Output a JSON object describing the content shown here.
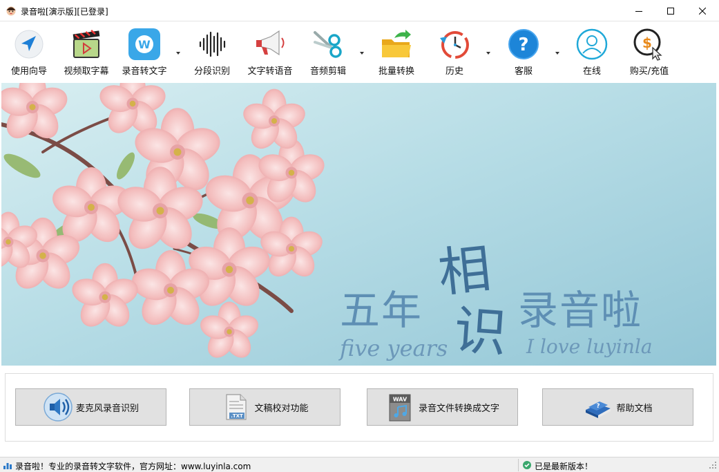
{
  "window": {
    "title": "录音啦[演示版][已登录]"
  },
  "toolbar": {
    "items": [
      {
        "label": "使用向导",
        "icon": "navigation-arrow-icon"
      },
      {
        "label": "视频取字幕",
        "icon": "video-clapper-icon"
      },
      {
        "label": "录音转文字",
        "icon": "w-logo-icon"
      },
      {
        "label": "分段识别",
        "icon": "waveform-icon"
      },
      {
        "label": "文字转语音",
        "icon": "megaphone-icon"
      },
      {
        "label": "音频剪辑",
        "icon": "scissors-icon"
      },
      {
        "label": "批量转换",
        "icon": "folder-arrow-icon"
      },
      {
        "label": "历史",
        "icon": "history-clock-icon"
      },
      {
        "label": "客服",
        "icon": "help-question-icon"
      },
      {
        "label": "在线",
        "icon": "user-online-icon"
      },
      {
        "label": "购买/充值",
        "icon": "dollar-cursor-icon"
      }
    ]
  },
  "banner": {
    "line_left": "五年",
    "line_top": "相",
    "line_bottom": "识",
    "line_right": "录音啦",
    "en_left": "five years",
    "en_right": "I love luyinla"
  },
  "functions": [
    {
      "label": "麦克风录音识别",
      "icon": "speaker-icon"
    },
    {
      "label": "文稿校对功能",
      "icon": "txt-document-icon"
    },
    {
      "label": "录音文件转换成文字",
      "icon": "wav-file-icon"
    },
    {
      "label": "帮助文档",
      "icon": "help-book-icon"
    }
  ],
  "status": {
    "left": "录音啦！专业的录音转文字软件，官方网址：www.luyinla.com",
    "right": "已是最新版本！"
  },
  "colors": {
    "banner_sky": "#a9d3e0",
    "banner_text": "#5e8fb4",
    "banner_text_dark": "#3f6f97",
    "button_face": "#e1e1e1",
    "status_ok": "#3aa76d"
  }
}
